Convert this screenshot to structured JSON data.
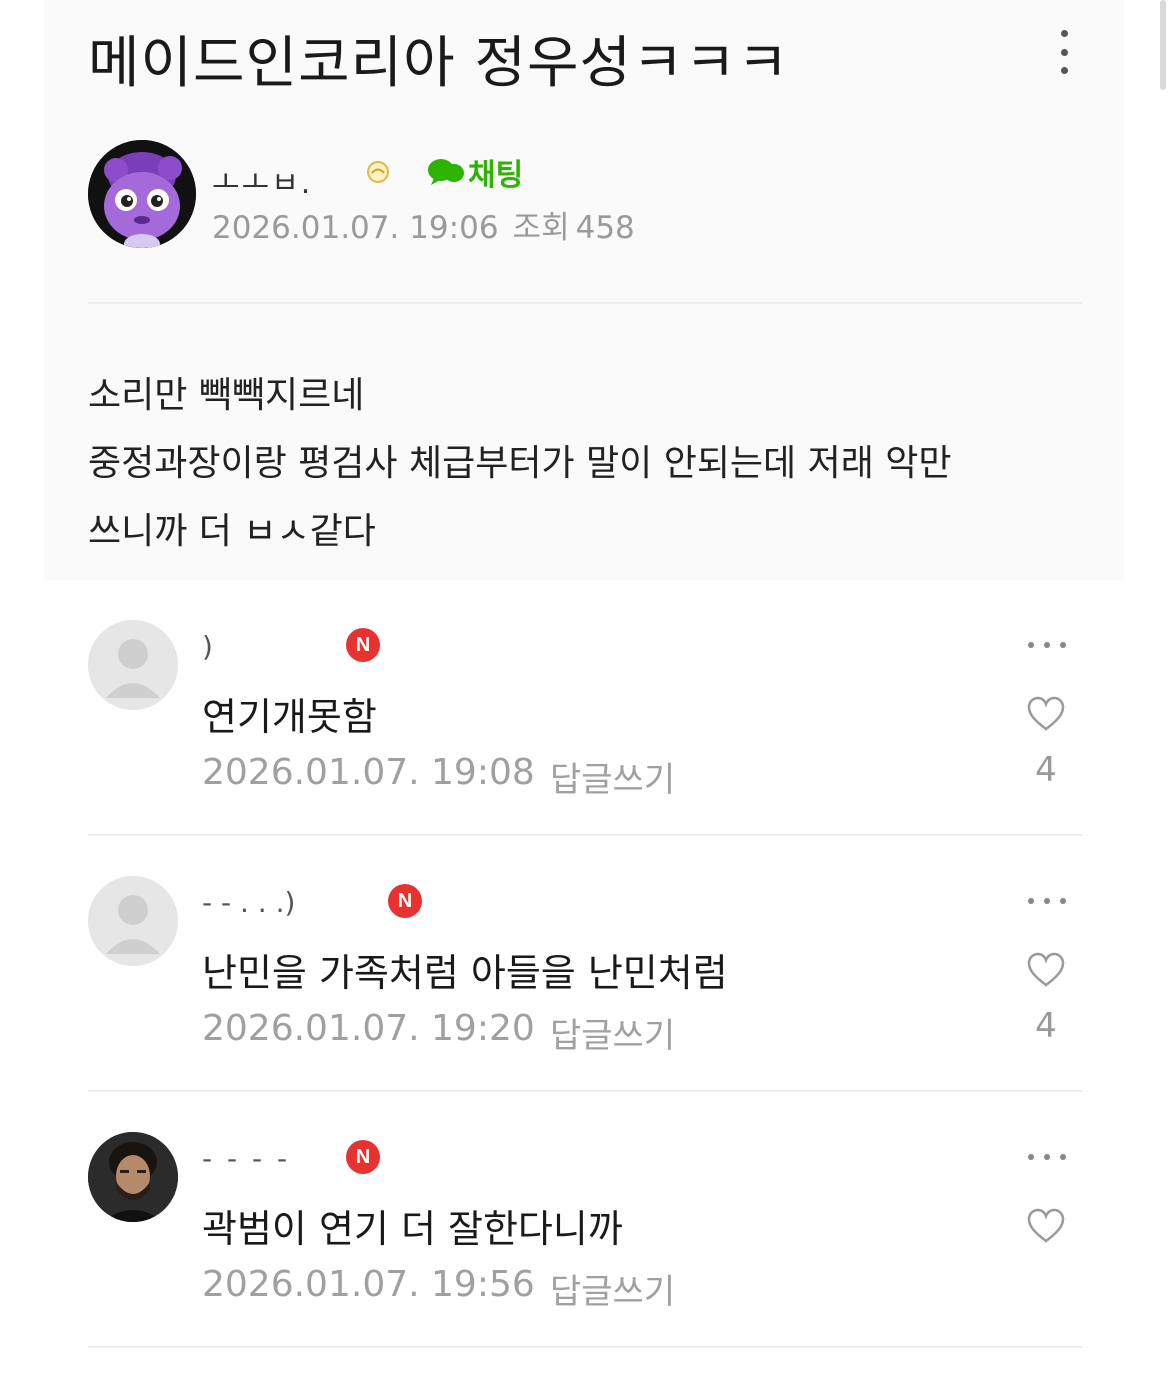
{
  "post": {
    "title": "메이드인코리아 정우성ㅋㅋㅋ",
    "author": {
      "name": "ㅗㅗㅂ.",
      "chat_label": "채팅"
    },
    "date": "2026.01.07. 19:06",
    "views_label": "조회",
    "views": "458",
    "body_lines": [
      "소리만 빽빽지르네",
      "중정과장이랑 평검사 체급부터가 말이 안되는데 저래 악만",
      "쓰니까 더 ㅂㅅ같다"
    ]
  },
  "comments": [
    {
      "name": ")",
      "badge": "N",
      "text": "연기개못함",
      "date": "2026.01.07. 19:08",
      "reply_label": "답글쓰기",
      "likes": "4"
    },
    {
      "name": "- - . . .)",
      "badge": "N",
      "text": "난민을 가족처럼 아들을 난민처럼",
      "date": "2026.01.07. 19:20",
      "reply_label": "답글쓰기",
      "likes": "4"
    },
    {
      "name": "- - - -",
      "badge": "N",
      "text": "곽범이 연기 더 잘한다니까",
      "date": "2026.01.07. 19:56",
      "reply_label": "답글쓰기",
      "likes": ""
    }
  ],
  "colors": {
    "chat_green": "#2db400",
    "new_badge_red": "#e8322f",
    "meta_gray": "#9a9a9a",
    "avatar_purple": "#a46ad9"
  },
  "icons": {
    "more": "kebab-vertical-icon",
    "chat": "chat-bubble-icon",
    "like": "heart-outline-icon",
    "comment_more": "ellipsis-horizontal-icon"
  }
}
